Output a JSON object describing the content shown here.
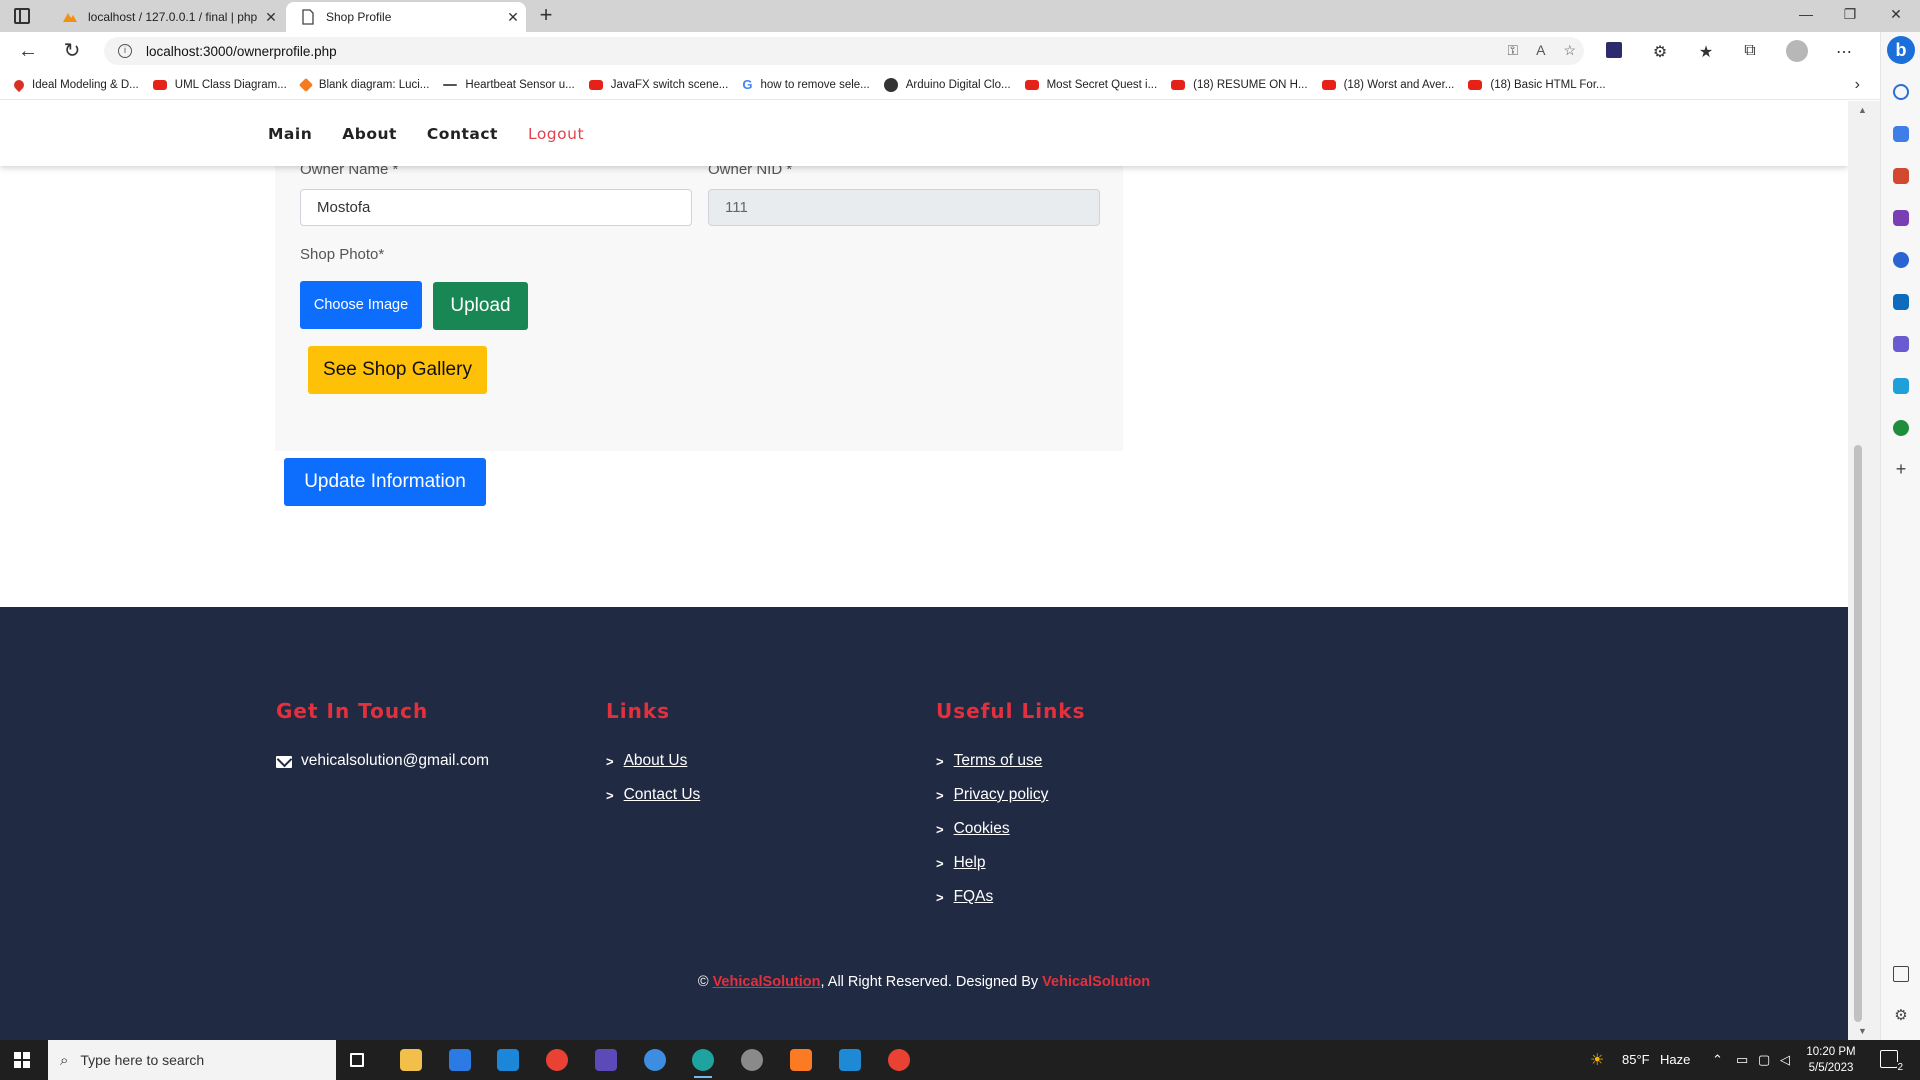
{
  "browser": {
    "tabs": [
      {
        "title": "localhost / 127.0.0.1 / final | php…",
        "active": false
      },
      {
        "title": "Shop Profile",
        "active": true
      }
    ],
    "url": "localhost:3000/ownerprofile.php",
    "bookmarks": [
      {
        "label": "Ideal Modeling & D...",
        "icon": "pin"
      },
      {
        "label": "UML Class Diagram...",
        "icon": "youtube"
      },
      {
        "label": "Blank diagram: Luci...",
        "icon": "lucid"
      },
      {
        "label": "Heartbeat Sensor u...",
        "icon": "dash"
      },
      {
        "label": "JavaFX switch scene...",
        "icon": "youtube"
      },
      {
        "label": "how to remove sele...",
        "icon": "google"
      },
      {
        "label": "Arduino Digital Clo...",
        "icon": "arduino"
      },
      {
        "label": "Most Secret Quest i...",
        "icon": "youtube"
      },
      {
        "label": "(18) RESUME ON H...",
        "icon": "youtube"
      },
      {
        "label": "(18) Worst and Aver...",
        "icon": "youtube"
      },
      {
        "label": "(18) Basic HTML For...",
        "icon": "youtube"
      }
    ]
  },
  "nav": {
    "main": "Main",
    "about": "About",
    "contact": "Contact",
    "logout": "Logout"
  },
  "form": {
    "owner_name_label": "Owner Name *",
    "owner_name_value": "Mostofa",
    "owner_nid_label": "Owner NID *",
    "owner_nid_value": "111",
    "shop_photo_label": "Shop Photo*",
    "choose_image": "Choose Image",
    "upload": "Upload",
    "see_gallery": "See Shop Gallery",
    "update": "Update Information"
  },
  "footer": {
    "get_in_touch": "Get In Touch",
    "email": "vehicalsolution@gmail.com",
    "links_title": "Links",
    "links": [
      "About Us",
      "Contact Us"
    ],
    "useful_title": "Useful Links",
    "useful": [
      "Terms of use",
      "Privacy policy",
      "Cookies",
      "Help",
      "FQAs"
    ],
    "copyright_prefix": "©",
    "brand": "VehicalSolution",
    "rights": ", All Right Reserved. Designed By",
    "designer": "VehicalSolution"
  },
  "taskbar": {
    "search_placeholder": "Type here to search",
    "weather_temp": "85°F",
    "weather_desc": "Haze",
    "time": "10:20 PM",
    "date": "5/5/2023",
    "notifications": "2"
  },
  "colors": {
    "primary": "#0d6efd",
    "success": "#198754",
    "warning": "#ffc107",
    "footer_bg": "#212a43",
    "accent_red": "#e3303d"
  }
}
